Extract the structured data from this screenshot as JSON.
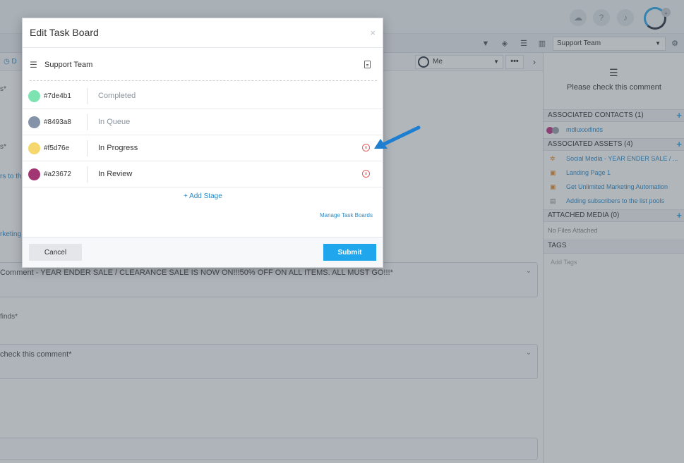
{
  "background": {
    "toolbar_left_label": "D",
    "team_select": {
      "value": "Support Team"
    },
    "assignee": {
      "value": "Me"
    },
    "more_label": "•••",
    "next_label": "›",
    "edge_texts": [
      "s*",
      "s*",
      "rs to the",
      "rketing"
    ],
    "comment_1": "Comment - YEAR ENDER SALE / CLEARANCE SALE IS NOW ON!!!50% OFF ON ALL ITEMS. ALL MUST GO!!!*",
    "finds_label": "finds*",
    "comment_2": "check this comment*"
  },
  "sidebar": {
    "title": "Please check this comment",
    "sections": {
      "contacts": {
        "label": "ASSOCIATED CONTACTS (1)",
        "items": [
          "mdluxxxfinds"
        ]
      },
      "assets": {
        "label": "ASSOCIATED ASSETS (4)",
        "items": [
          "Social Media - YEAR ENDER SALE / ...",
          "Landing Page 1",
          "Get Unlimited Marketing Automation",
          "Adding subscribers to the list pools"
        ]
      },
      "media": {
        "label": "ATTACHED MEDIA (0)",
        "empty": "No Files Attached"
      },
      "tags": {
        "label": "TAGS",
        "placeholder": "Add Tags"
      }
    }
  },
  "modal": {
    "title": "Edit Task Board",
    "close": "×",
    "board_name": "Support Team",
    "stages": [
      {
        "color": "#7de4b1",
        "hex": "#7de4b1",
        "name": "Completed",
        "removable": false
      },
      {
        "color": "#8493a8",
        "hex": "#8493a8",
        "name": "In Queue",
        "removable": false
      },
      {
        "color": "#f5d76e",
        "hex": "#f5d76e",
        "name": "In Progress",
        "removable": true
      },
      {
        "color": "#a23672",
        "hex": "#a23672",
        "name": "In Review",
        "removable": true
      }
    ],
    "add_stage": "+ Add Stage",
    "manage_link": "Manage Task Boards",
    "cancel": "Cancel",
    "submit": "Submit"
  },
  "colors": {
    "accent": "#1fa6ec",
    "link": "#2a89c8",
    "remove": "#e25d5d",
    "annotation_arrow": "#1e7fd0"
  }
}
